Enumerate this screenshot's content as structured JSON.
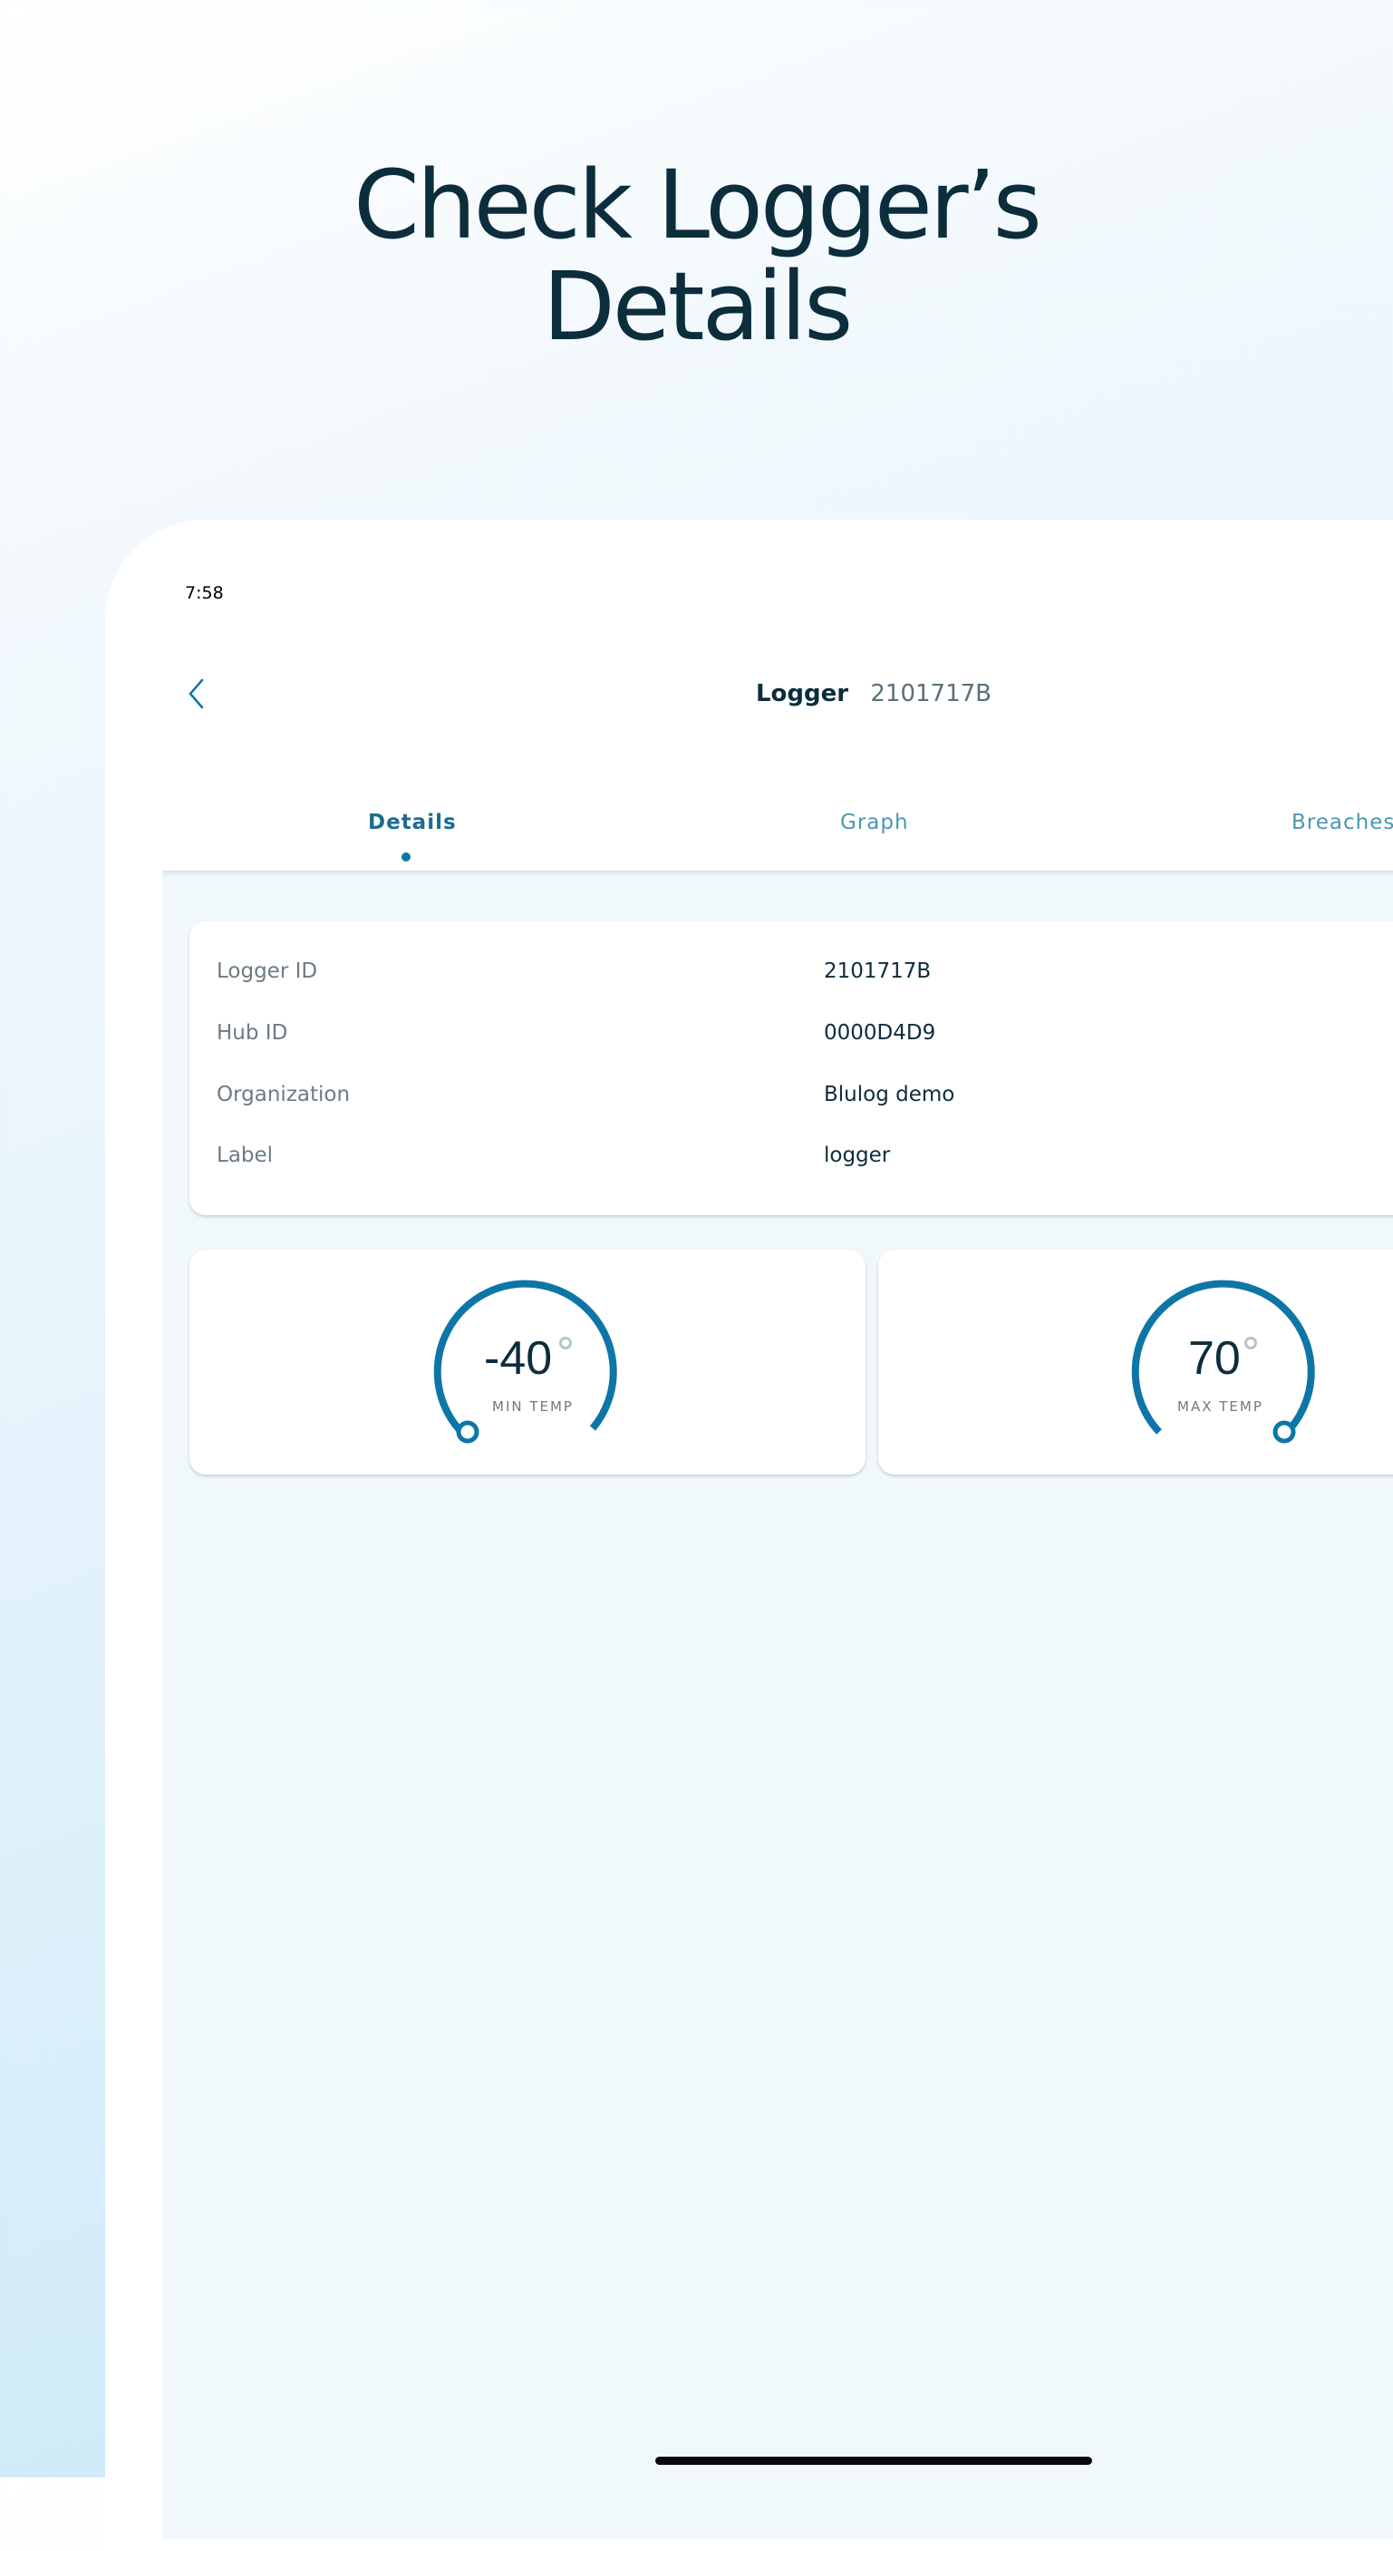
{
  "headline": {
    "line1": "Check Logger’s",
    "line2": "Details"
  },
  "status_bar": {
    "time": "7:58"
  },
  "nav": {
    "title": "Logger",
    "subtitle": "2101717B",
    "back_icon": "chevron-left-icon"
  },
  "tabs": [
    {
      "label": "Details",
      "active": true
    },
    {
      "label": "Graph",
      "active": false
    },
    {
      "label": "Breaches",
      "active": false
    }
  ],
  "details": {
    "rows": [
      {
        "label": "Logger ID",
        "value": "2101717B"
      },
      {
        "label": "Hub ID",
        "value": "0000D4D9"
      },
      {
        "label": "Organization",
        "value": "Blulog demo"
      },
      {
        "label": "Label",
        "value": "logger"
      }
    ]
  },
  "gauges": {
    "min": {
      "value": "-40",
      "caption": "MIN TEMP"
    },
    "max": {
      "value": "70",
      "caption": "MAX TEMP"
    }
  },
  "colors": {
    "accent": "#0e76a6",
    "heading": "#0c2d3b",
    "tab_inactive": "#4a97b1",
    "screen_bg": "#f1f8fb"
  }
}
